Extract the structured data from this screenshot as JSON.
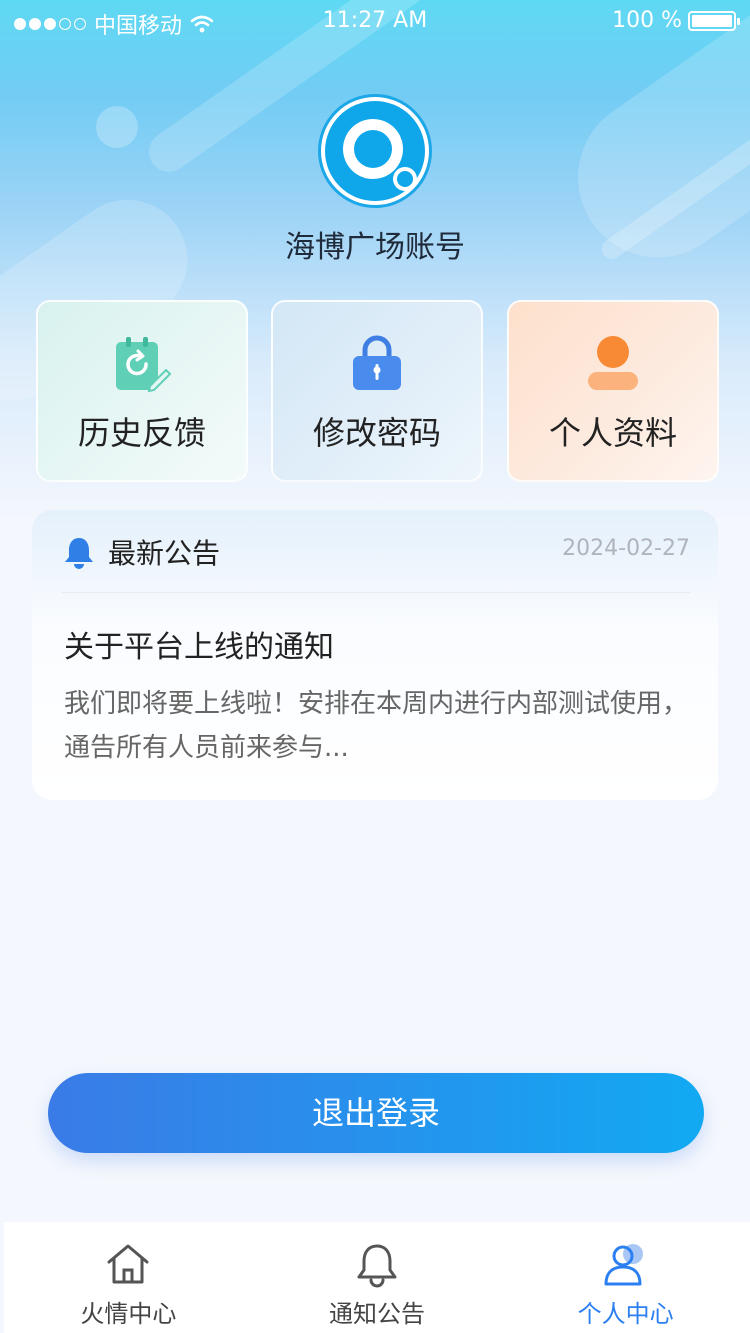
{
  "status_bar": {
    "carrier": "中国移动",
    "time": "11:27 AM",
    "battery": "100 %"
  },
  "profile": {
    "account_name": "海博广场账号"
  },
  "quick_actions": [
    {
      "label": "历史反馈",
      "icon": "clipboard-refresh-icon"
    },
    {
      "label": "修改密码",
      "icon": "lock-icon"
    },
    {
      "label": "个人资料",
      "icon": "user-icon"
    }
  ],
  "announcement": {
    "section_title": "最新公告",
    "date": "2024-02-27",
    "heading": "关于平台上线的通知",
    "body": "我们即将要上线啦！安排在本周内进行内部测试使用，通告所有人员前来参与..."
  },
  "logout_label": "退出登录",
  "tabbar": {
    "items": [
      {
        "label": "火情中心",
        "icon": "home-icon",
        "active": false
      },
      {
        "label": "通知公告",
        "icon": "bell-icon",
        "active": false
      },
      {
        "label": "个人中心",
        "icon": "user-icon",
        "active": true
      }
    ]
  },
  "colors": {
    "accent": "#2b7ff0",
    "logout_start": "#3a7be7",
    "logout_end": "#12a9f2"
  }
}
